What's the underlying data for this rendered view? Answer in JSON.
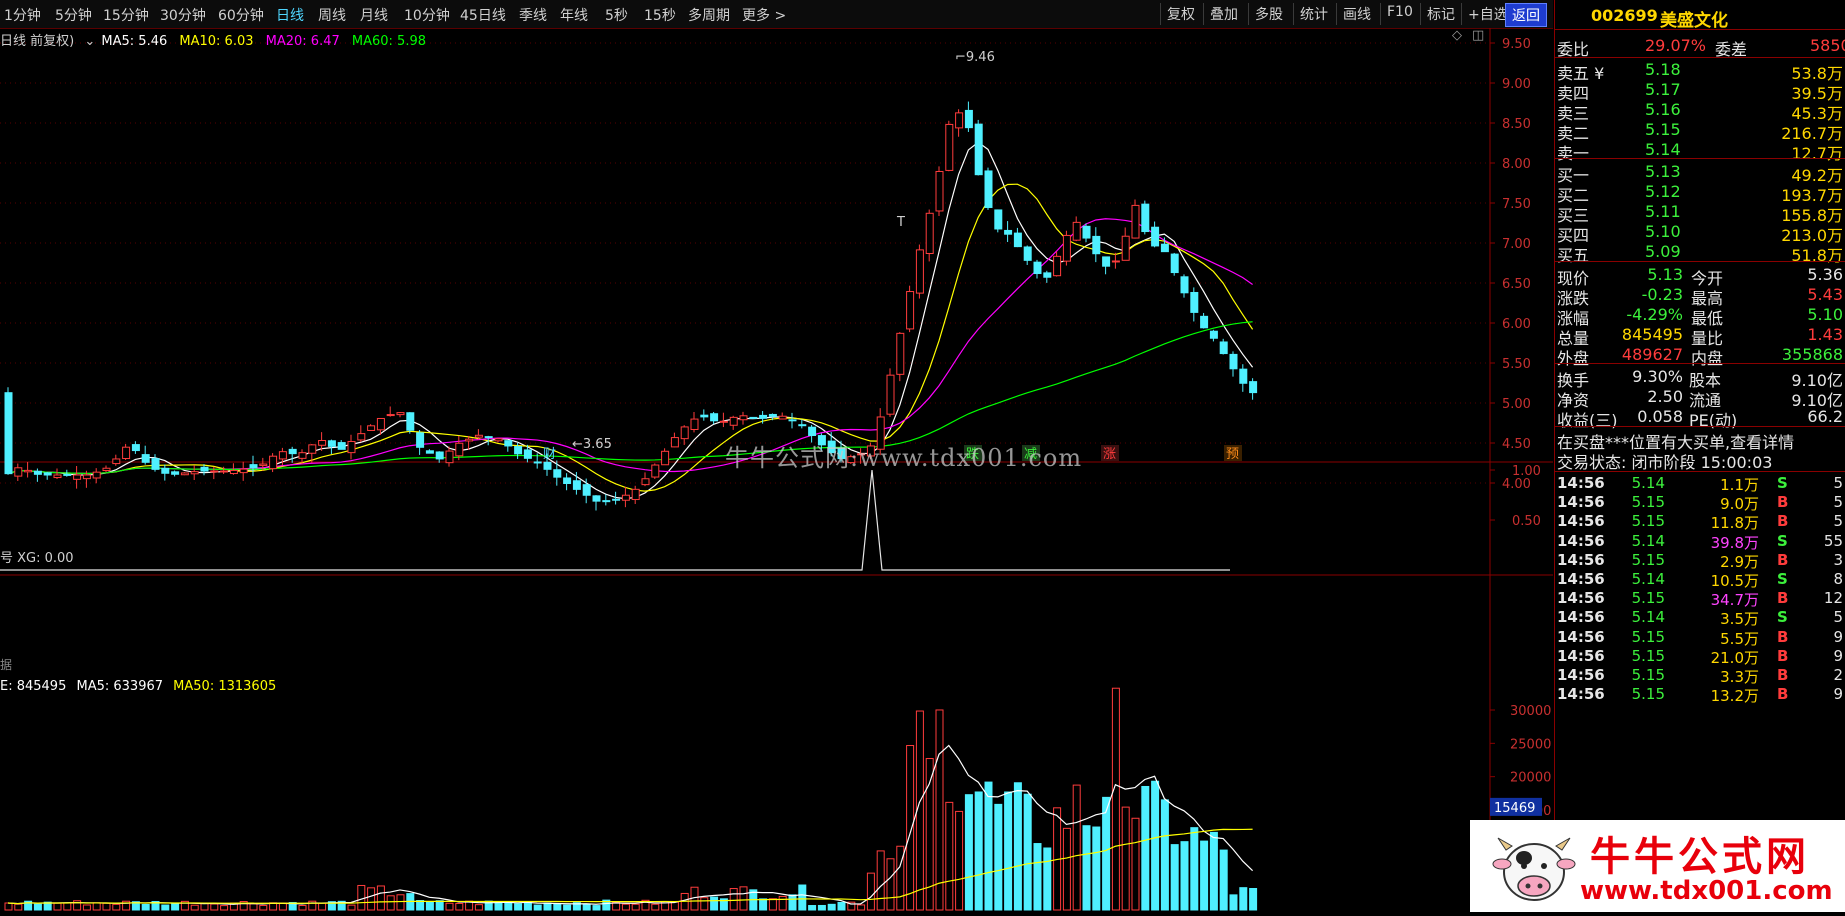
{
  "toolbar": {
    "periods": [
      "1分钟",
      "5分钟",
      "15分钟",
      "30分钟",
      "60分钟",
      "日线",
      "周线",
      "月线",
      "10分钟",
      "45日线",
      "季线",
      "年线",
      "5秒",
      "15秒",
      "多周期",
      "更多 >"
    ],
    "active": "日线",
    "buttons": [
      "复权",
      "叠加",
      "多股",
      "统计",
      "画线",
      "F10",
      "标记",
      "+自选",
      "返回"
    ]
  },
  "main_legend": {
    "name": "日线 前复权)",
    "ma5": "MA5: 5.46",
    "ma10": "MA10: 6.03",
    "ma20": "MA20: 6.47",
    "ma60": "MA60: 5.98"
  },
  "colors": {
    "ma5": "#ffffff",
    "ma10": "#ffff00",
    "ma20": "#ff00ff",
    "ma60": "#00ff00",
    "up": "#ff3c3c",
    "down": "#4ff0ff",
    "grid": "#8a0000"
  },
  "annotations": {
    "high": "9.46",
    "low": "3.65",
    "t_mark": "T",
    "events": [
      "财",
      "跌",
      "减",
      "涨",
      "预"
    ]
  },
  "price_axis": [
    "9.50",
    "9.00",
    "8.50",
    "8.00",
    "7.50",
    "7.00",
    "6.50",
    "6.00",
    "5.50",
    "5.00",
    "4.50",
    "4.00"
  ],
  "xg_legend": "号 XG: 0.00",
  "xg_footer": "据",
  "xg_axis": [
    "1.00",
    "0.50"
  ],
  "vol_legend": {
    "vol": "E: 845495",
    "ma5": "MA5: 633967",
    "ma50": "MA50: 1313605"
  },
  "vol_axis": [
    "30000",
    "25000",
    "20000",
    "15000"
  ],
  "vol_cursor": "15469",
  "watermark": "牛牛公式网:www.tdx001.com",
  "logo": {
    "cn": "牛牛公式网",
    "url": "www.tdx001.com"
  },
  "side": {
    "code": "002699",
    "name": "美盛文化",
    "weibi_label": "委比",
    "weibi": "29.07%",
    "weicha_label": "委差",
    "weicha": "5850",
    "asks": [
      {
        "label": "卖五 ¥",
        "price": "5.18",
        "vol": "53.8万"
      },
      {
        "label": "卖四",
        "price": "5.17",
        "vol": "39.5万"
      },
      {
        "label": "卖三",
        "price": "5.16",
        "vol": "45.3万"
      },
      {
        "label": "卖二",
        "price": "5.15",
        "vol": "216.7万"
      },
      {
        "label": "卖一",
        "price": "5.14",
        "vol": "12.7万"
      }
    ],
    "bids": [
      {
        "label": "买一",
        "price": "5.13",
        "vol": "49.2万"
      },
      {
        "label": "买二",
        "price": "5.12",
        "vol": "193.7万"
      },
      {
        "label": "买三",
        "price": "5.11",
        "vol": "155.8万"
      },
      {
        "label": "买四",
        "price": "5.10",
        "vol": "213.0万"
      },
      {
        "label": "买五",
        "price": "5.09",
        "vol": "51.8万"
      }
    ],
    "quote": [
      {
        "l1": "现价",
        "v1": "5.13",
        "c1": "green",
        "l2": "今开",
        "v2": "5.36",
        "c2": "white"
      },
      {
        "l1": "涨跌",
        "v1": "-0.23",
        "c1": "green",
        "l2": "最高",
        "v2": "5.43",
        "c2": "red"
      },
      {
        "l1": "涨幅",
        "v1": "-4.29%",
        "c1": "green",
        "l2": "最低",
        "v2": "5.10",
        "c2": "green"
      },
      {
        "l1": "总量",
        "v1": "845495",
        "c1": "yellow",
        "l2": "量比",
        "v2": "1.43",
        "c2": "red"
      },
      {
        "l1": "外盘",
        "v1": "489627",
        "c1": "red",
        "l2": "内盘",
        "v2": "355868",
        "c2": "green"
      }
    ],
    "fund": [
      {
        "l1": "换手",
        "v1": "9.30%",
        "l2": "股本",
        "v2": "9.10亿"
      },
      {
        "l1": "净资",
        "v1": "2.50",
        "l2": "流通",
        "v2": "9.10亿"
      },
      {
        "l1": "收益(三)",
        "v1": "0.058",
        "l2": "PE(动)",
        "v2": "66.2"
      }
    ],
    "notice": "在买盘***位置有大买单,查看详情",
    "status": "交易状态: 闭市阶段 15:00:03",
    "ticks": [
      {
        "t": "14:56",
        "p": "5.14",
        "v": "1.1万",
        "bs": "S",
        "n": "5"
      },
      {
        "t": "14:56",
        "p": "5.15",
        "v": "9.0万",
        "bs": "B",
        "n": "5"
      },
      {
        "t": "14:56",
        "p": "5.15",
        "v": "11.8万",
        "bs": "B",
        "n": "5"
      },
      {
        "t": "14:56",
        "p": "5.14",
        "v": "39.8万",
        "bs": "S",
        "n": "55"
      },
      {
        "t": "14:56",
        "p": "5.15",
        "v": "2.9万",
        "bs": "B",
        "n": "3"
      },
      {
        "t": "14:56",
        "p": "5.14",
        "v": "10.5万",
        "bs": "S",
        "n": "8"
      },
      {
        "t": "14:56",
        "p": "5.15",
        "v": "34.7万",
        "bs": "B",
        "n": "12"
      },
      {
        "t": "14:56",
        "p": "5.14",
        "v": "3.5万",
        "bs": "S",
        "n": "5"
      },
      {
        "t": "14:56",
        "p": "5.15",
        "v": "5.5万",
        "bs": "B",
        "n": "9"
      },
      {
        "t": "14:56",
        "p": "5.15",
        "v": "21.0万",
        "bs": "B",
        "n": "9"
      },
      {
        "t": "14:56",
        "p": "5.15",
        "v": "3.3万",
        "bs": "B",
        "n": "2"
      },
      {
        "t": "14:56",
        "p": "5.15",
        "v": "13.2万",
        "bs": "B",
        "n": "9"
      }
    ]
  }
}
